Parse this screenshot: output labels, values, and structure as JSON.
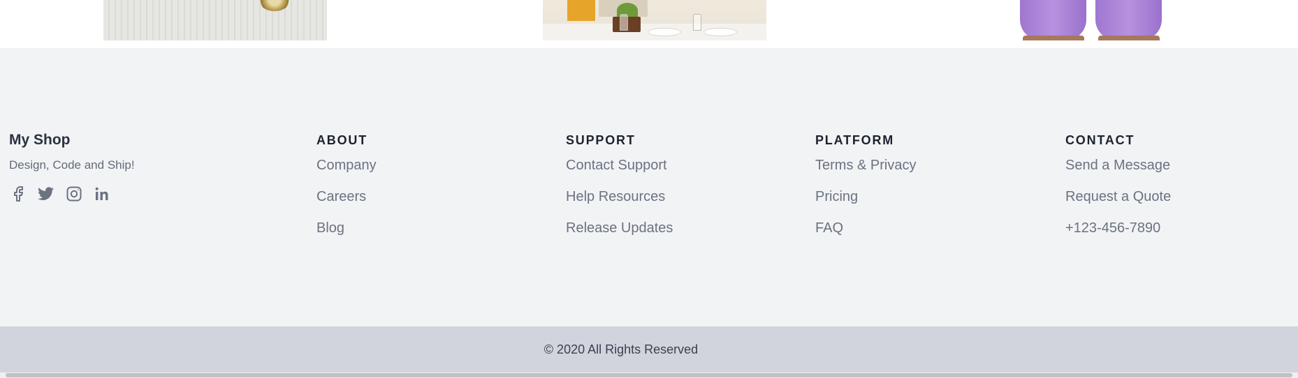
{
  "footer": {
    "brand": {
      "title": "My Shop",
      "tagline": "Design, Code and Ship!",
      "socials": [
        "facebook-icon",
        "twitter-icon",
        "instagram-icon",
        "linkedin-icon"
      ]
    },
    "columns": [
      {
        "title": "ABOUT",
        "links": [
          "Company",
          "Careers",
          "Blog"
        ]
      },
      {
        "title": "SUPPORT",
        "links": [
          "Contact Support",
          "Help Resources",
          "Release Updates"
        ]
      },
      {
        "title": "PLATFORM",
        "links": [
          "Terms & Privacy",
          "Pricing",
          "FAQ"
        ]
      },
      {
        "title": "CONTACT",
        "links": [
          "Send a Message",
          "Request a Quote",
          "+123-456-7890"
        ]
      }
    ]
  },
  "copyright": "© 2020 All Rights Reserved",
  "colors": {
    "footer_bg": "#f2f3f5",
    "copyright_bg": "#d1d4dd",
    "link": "#6b7280",
    "heading": "#1d2230"
  }
}
